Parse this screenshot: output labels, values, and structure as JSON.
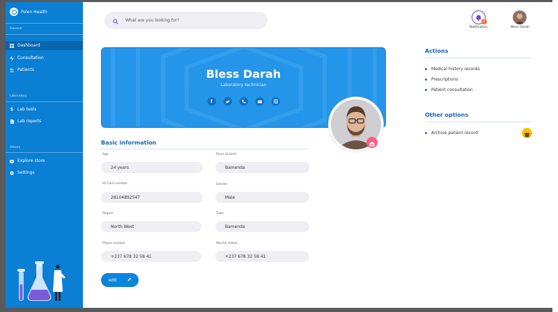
{
  "app": {
    "name": "Polen Health"
  },
  "sidebar": {
    "sections": [
      {
        "label": "General"
      },
      {
        "label": "Laboratory"
      },
      {
        "label": "Others"
      }
    ],
    "items": [
      {
        "label": "Dashboard",
        "icon": "grid-icon"
      },
      {
        "label": "Consultation",
        "icon": "pulse-icon"
      },
      {
        "label": "Patients",
        "icon": "users-icon"
      },
      {
        "label": "Lab tests",
        "icon": "dollar-icon"
      },
      {
        "label": "Lab reports",
        "icon": "document-icon"
      },
      {
        "label": "Explore store",
        "icon": "store-icon"
      },
      {
        "label": "Settings",
        "icon": "gear-icon"
      }
    ]
  },
  "search": {
    "placeholder": "What are you looking for?"
  },
  "topbar": {
    "notification_label": "Notification",
    "notification_count": "2",
    "user_label": "Bless Darah"
  },
  "profile": {
    "name": "Bless Darah",
    "role": "Laboratory technician",
    "socials": [
      "facebook-icon",
      "twitter-icon",
      "phone-icon",
      "mail-icon",
      "instagram-icon"
    ]
  },
  "basic_info": {
    "title": "Basic information",
    "fields": [
      {
        "label": "Age",
        "value": "24 years"
      },
      {
        "label": "Place of birth",
        "value": "Bamenda"
      },
      {
        "label": "ID Card number",
        "value": "28104892547"
      },
      {
        "label": "Gender",
        "value": "Male"
      },
      {
        "label": "Region",
        "value": "North West"
      },
      {
        "label": "Town",
        "value": "Bamenda"
      },
      {
        "label": "Phone number",
        "value": "+237 678 32 58 41"
      },
      {
        "label": "Marital status",
        "value": "+237 678 32 58 41"
      }
    ],
    "edit_label": "edit"
  },
  "actions": {
    "title": "Actions",
    "items": [
      "Medical history records",
      "Prescriptions",
      "Patient consultation"
    ]
  },
  "other_options": {
    "title": "Other options",
    "items": [
      "Archive patient record"
    ]
  },
  "colors": {
    "sidebar": "#0a7fd3",
    "banner": "#2495e8",
    "accent_title": "#1565b8",
    "camera_button": "#ff5b7f",
    "archive_button": "#ffc400"
  }
}
